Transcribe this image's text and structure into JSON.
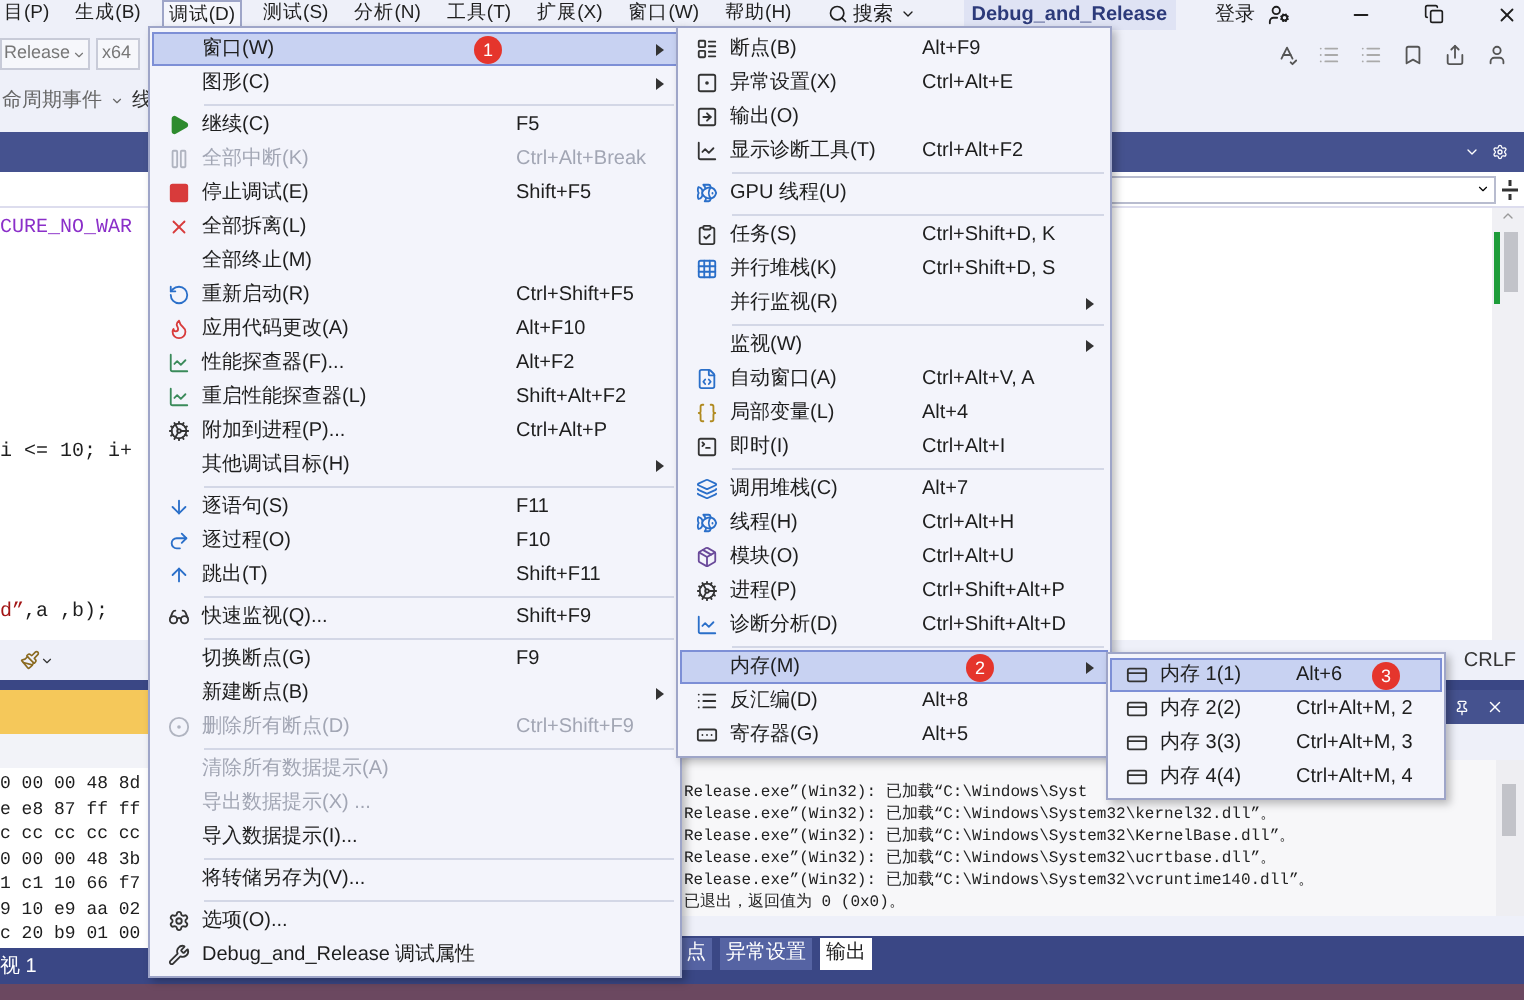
{
  "menubar": [
    {
      "label": "目(P)",
      "selected": false
    },
    {
      "label": "生成(B)",
      "selected": false
    },
    {
      "label": "调试(D)",
      "selected": true
    },
    {
      "label": "测试(S)",
      "selected": false
    },
    {
      "label": "分析(N)",
      "selected": false
    },
    {
      "label": "工具(T)",
      "selected": false
    },
    {
      "label": "扩展(X)",
      "selected": false
    },
    {
      "label": "窗口(W)",
      "selected": false
    },
    {
      "label": "帮助(H)",
      "selected": false
    }
  ],
  "search": "搜索",
  "window_title": "Debug_and_Release",
  "login": "登录",
  "toolbar": {
    "configuration": "Release",
    "platform": "x64"
  },
  "events_toolbar": {
    "event": "命周期事件",
    "thread_label": "线"
  },
  "code_lines": [
    [
      {
        "text": "CURE_NO_WAR",
        "kind": "macro"
      }
    ],
    [
      {
        "text": "i <= 10; i+",
        "kind": "plain"
      }
    ],
    [
      {
        "text": "d”",
        "kind": "string"
      },
      {
        "text": ",a ,b);",
        "kind": "plain"
      }
    ]
  ],
  "line_ending": "CRLF",
  "memory_rows": [
    "0 00 00 48 8d",
    "e e8 87 ff ff",
    "c cc cc cc cc",
    "0 00 00 48 3b",
    "1 c1 10 66 f7",
    "9 10 e9 aa 02",
    "c 20 b9 01 00"
  ],
  "memory_tab": "视 1",
  "output_lines": [
    "Release.exe”(Win32): 已加载“C:\\Windows\\Syst",
    "Release.exe”(Win32): 已加载“C:\\Windows\\System32\\kernel32.dll”。",
    "Release.exe”(Win32): 已加载“C:\\Windows\\System32\\KernelBase.dll”。",
    "Release.exe”(Win32): 已加载“C:\\Windows\\System32\\ucrtbase.dll”。",
    "Release.exe”(Win32): 已加载“C:\\Windows\\System32\\vcruntime140.dll”。",
    "已退出，返回值为 0 (0x0)。"
  ],
  "bottom_tabs": [
    {
      "label": "点",
      "selected": false
    },
    {
      "label": "异常设置",
      "selected": false
    },
    {
      "label": "输出",
      "selected": true
    }
  ],
  "menus": {
    "debug": [
      {
        "kind": "item",
        "label": "窗口(W)",
        "submenu": true,
        "disabled": false,
        "selected": true,
        "badge": "1"
      },
      {
        "kind": "item",
        "label": "图形(C)",
        "submenu": true,
        "disabled": false,
        "selected": false
      },
      {
        "kind": "separator"
      },
      {
        "kind": "item",
        "label": "继续(C)",
        "shortcut": "F5",
        "submenu": false,
        "disabled": false,
        "selected": false
      },
      {
        "kind": "item",
        "label": "全部中断(K)",
        "shortcut": "Ctrl+Alt+Break",
        "submenu": false,
        "disabled": true,
        "selected": false
      },
      {
        "kind": "item",
        "label": "停止调试(E)",
        "shortcut": "Shift+F5",
        "submenu": false,
        "disabled": false,
        "selected": false
      },
      {
        "kind": "item",
        "label": "全部拆离(L)",
        "submenu": false,
        "disabled": false,
        "selected": false
      },
      {
        "kind": "item",
        "label": "全部终止(M)",
        "submenu": false,
        "disabled": false,
        "selected": false
      },
      {
        "kind": "item",
        "label": "重新启动(R)",
        "shortcut": "Ctrl+Shift+F5",
        "submenu": false,
        "disabled": false,
        "selected": false
      },
      {
        "kind": "item",
        "label": "应用代码更改(A)",
        "shortcut": "Alt+F10",
        "submenu": false,
        "disabled": false,
        "selected": false
      },
      {
        "kind": "item",
        "label": "性能探查器(F)...",
        "shortcut": "Alt+F2",
        "submenu": false,
        "disabled": false,
        "selected": false
      },
      {
        "kind": "item",
        "label": "重启性能探查器(L)",
        "shortcut": "Shift+Alt+F2",
        "submenu": false,
        "disabled": false,
        "selected": false
      },
      {
        "kind": "item",
        "label": "附加到进程(P)...",
        "shortcut": "Ctrl+Alt+P",
        "submenu": false,
        "disabled": false,
        "selected": false
      },
      {
        "kind": "item",
        "label": "其他调试目标(H)",
        "submenu": true,
        "disabled": false,
        "selected": false
      },
      {
        "kind": "separator"
      },
      {
        "kind": "item",
        "label": "逐语句(S)",
        "shortcut": "F11",
        "submenu": false,
        "disabled": false,
        "selected": false
      },
      {
        "kind": "item",
        "label": "逐过程(O)",
        "shortcut": "F10",
        "submenu": false,
        "disabled": false,
        "selected": false
      },
      {
        "kind": "item",
        "label": "跳出(T)",
        "shortcut": "Shift+F11",
        "submenu": false,
        "disabled": false,
        "selected": false
      },
      {
        "kind": "separator"
      },
      {
        "kind": "item",
        "label": "快速监视(Q)...",
        "shortcut": "Shift+F9",
        "submenu": false,
        "disabled": false,
        "selected": false
      },
      {
        "kind": "separator"
      },
      {
        "kind": "item",
        "label": "切换断点(G)",
        "shortcut": "F9",
        "submenu": false,
        "disabled": false,
        "selected": false
      },
      {
        "kind": "item",
        "label": "新建断点(B)",
        "submenu": true,
        "disabled": false,
        "selected": false
      },
      {
        "kind": "item",
        "label": "删除所有断点(D)",
        "shortcut": "Ctrl+Shift+F9",
        "submenu": false,
        "disabled": true,
        "selected": false
      },
      {
        "kind": "separator"
      },
      {
        "kind": "item",
        "label": "清除所有数据提示(A)",
        "submenu": false,
        "disabled": true,
        "selected": false
      },
      {
        "kind": "item",
        "label": "导出数据提示(X) ...",
        "submenu": false,
        "disabled": true,
        "selected": false
      },
      {
        "kind": "item",
        "label": "导入数据提示(I)...",
        "submenu": false,
        "disabled": false,
        "selected": false
      },
      {
        "kind": "separator"
      },
      {
        "kind": "item",
        "label": "将转储另存为(V)...",
        "submenu": false,
        "disabled": false,
        "selected": false
      },
      {
        "kind": "separator"
      },
      {
        "kind": "item",
        "label": "选项(O)...",
        "submenu": false,
        "disabled": false,
        "selected": false
      },
      {
        "kind": "item",
        "label": "Debug_and_Release 调试属性",
        "submenu": false,
        "disabled": false,
        "selected": false
      }
    ],
    "windows": [
      {
        "kind": "item",
        "label": "断点(B)",
        "shortcut": "Alt+F9",
        "submenu": false,
        "disabled": false,
        "selected": false
      },
      {
        "kind": "item",
        "label": "异常设置(X)",
        "shortcut": "Ctrl+Alt+E",
        "submenu": false,
        "disabled": false,
        "selected": false
      },
      {
        "kind": "item",
        "label": "输出(O)",
        "submenu": false,
        "disabled": false,
        "selected": false
      },
      {
        "kind": "item",
        "label": "显示诊断工具(T)",
        "shortcut": "Ctrl+Alt+F2",
        "submenu": false,
        "disabled": false,
        "selected": false
      },
      {
        "kind": "separator"
      },
      {
        "kind": "item",
        "label": "GPU 线程(U)",
        "submenu": false,
        "disabled": false,
        "selected": false
      },
      {
        "kind": "separator"
      },
      {
        "kind": "item",
        "label": "任务(S)",
        "shortcut": "Ctrl+Shift+D, K",
        "submenu": false,
        "disabled": false,
        "selected": false
      },
      {
        "kind": "item",
        "label": "并行堆栈(K)",
        "shortcut": "Ctrl+Shift+D, S",
        "submenu": false,
        "disabled": false,
        "selected": false
      },
      {
        "kind": "item",
        "label": "并行监视(R)",
        "submenu": true,
        "disabled": false,
        "selected": false
      },
      {
        "kind": "separator"
      },
      {
        "kind": "item",
        "label": "监视(W)",
        "submenu": true,
        "disabled": false,
        "selected": false
      },
      {
        "kind": "item",
        "label": "自动窗口(A)",
        "shortcut": "Ctrl+Alt+V, A",
        "submenu": false,
        "disabled": false,
        "selected": false
      },
      {
        "kind": "item",
        "label": "局部变量(L)",
        "shortcut": "Alt+4",
        "submenu": false,
        "disabled": false,
        "selected": false
      },
      {
        "kind": "item",
        "label": "即时(I)",
        "shortcut": "Ctrl+Alt+I",
        "submenu": false,
        "disabled": false,
        "selected": false
      },
      {
        "kind": "separator"
      },
      {
        "kind": "item",
        "label": "调用堆栈(C)",
        "shortcut": "Alt+7",
        "submenu": false,
        "disabled": false,
        "selected": false
      },
      {
        "kind": "item",
        "label": "线程(H)",
        "shortcut": "Ctrl+Alt+H",
        "submenu": false,
        "disabled": false,
        "selected": false
      },
      {
        "kind": "item",
        "label": "模块(O)",
        "shortcut": "Ctrl+Alt+U",
        "submenu": false,
        "disabled": false,
        "selected": false
      },
      {
        "kind": "item",
        "label": "进程(P)",
        "shortcut": "Ctrl+Shift+Alt+P",
        "submenu": false,
        "disabled": false,
        "selected": false
      },
      {
        "kind": "item",
        "label": "诊断分析(D)",
        "shortcut": "Ctrl+Shift+Alt+D",
        "submenu": false,
        "disabled": false,
        "selected": false
      },
      {
        "kind": "separator"
      },
      {
        "kind": "item",
        "label": "内存(M)",
        "submenu": true,
        "disabled": false,
        "selected": true,
        "badge": "2"
      },
      {
        "kind": "item",
        "label": "反汇编(D)",
        "shortcut": "Alt+8",
        "submenu": false,
        "disabled": false,
        "selected": false
      },
      {
        "kind": "item",
        "label": "寄存器(G)",
        "shortcut": "Alt+5",
        "submenu": false,
        "disabled": false,
        "selected": false
      }
    ],
    "memory": [
      {
        "kind": "item",
        "label": "内存 1(1)",
        "shortcut": "Alt+6",
        "disabled": false,
        "selected": true,
        "badge": "3"
      },
      {
        "kind": "item",
        "label": "内存 2(2)",
        "shortcut": "Ctrl+Alt+M, 2",
        "disabled": false,
        "selected": false
      },
      {
        "kind": "item",
        "label": "内存 3(3)",
        "shortcut": "Ctrl+Alt+M, 3",
        "disabled": false,
        "selected": false
      },
      {
        "kind": "item",
        "label": "内存 4(4)",
        "shortcut": "Ctrl+Alt+M, 4",
        "disabled": false,
        "selected": false
      }
    ]
  }
}
